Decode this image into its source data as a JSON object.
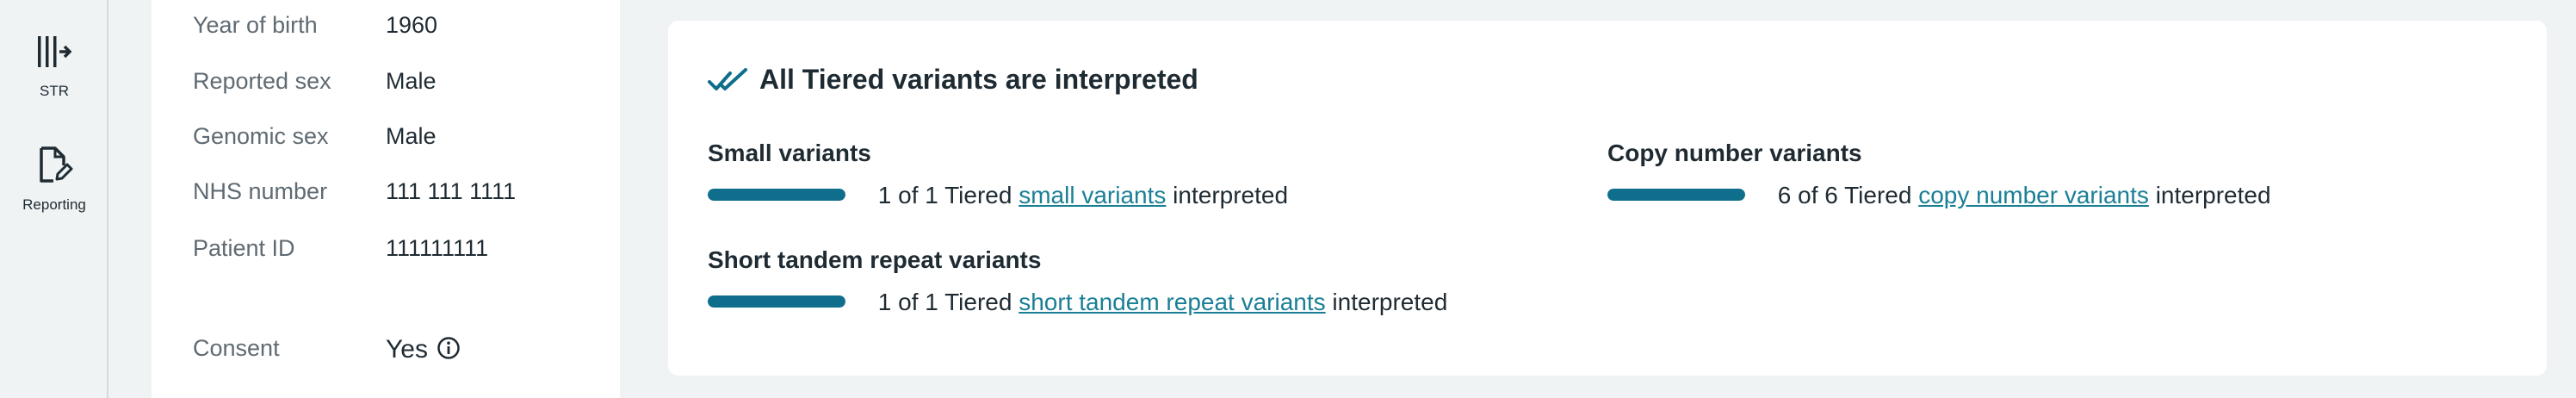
{
  "rail": {
    "items": [
      {
        "label": "STR",
        "icon": "str-columns-icon"
      },
      {
        "label": "Reporting",
        "icon": "report-edit-icon"
      }
    ]
  },
  "patient": {
    "rows": [
      {
        "label": "Year of birth",
        "value": "1960"
      },
      {
        "label": "Reported sex",
        "value": "Male"
      },
      {
        "label": "Genomic sex",
        "value": "Male"
      },
      {
        "label": "NHS number",
        "value": "111 111 1111"
      },
      {
        "label": "Patient ID",
        "value": "111111111"
      }
    ],
    "consent": {
      "label": "Consent",
      "value": "Yes",
      "icon": "info-icon"
    }
  },
  "summary": {
    "title": "All Tiered variants are interpreted",
    "icon": "double-check-icon",
    "groups": [
      {
        "title": "Small variants",
        "prefix": "1 of 1 Tiered",
        "link": "small variants",
        "suffix": "interpreted",
        "progress": 1.0
      },
      {
        "title": "Copy number variants",
        "prefix": "6 of 6 Tiered",
        "link": "copy number variants",
        "suffix": "interpreted",
        "progress": 1.0
      },
      {
        "title": "Short tandem repeat variants",
        "prefix": "1 of 1 Tiered",
        "link": "short tandem repeat variants",
        "suffix": "interpreted",
        "progress": 1.0
      }
    ]
  },
  "colors": {
    "accent": "#0f6e8c",
    "link": "#1a7f96"
  }
}
